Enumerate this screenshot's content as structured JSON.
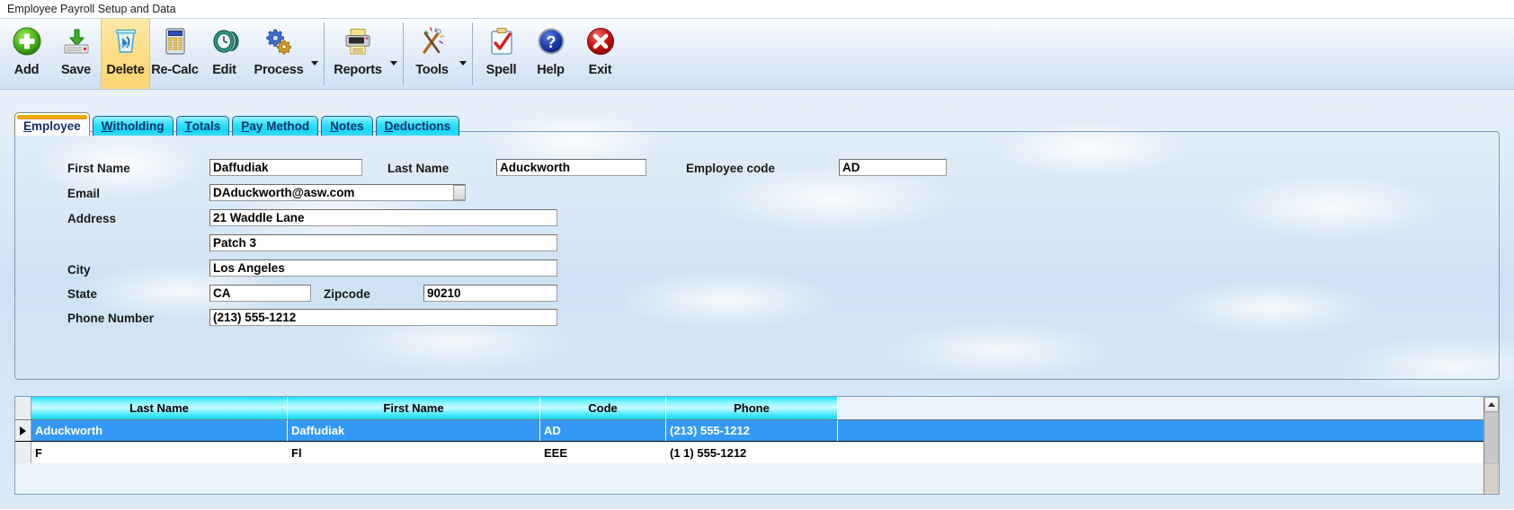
{
  "window": {
    "title": "Employee Payroll Setup and Data"
  },
  "toolbar": {
    "buttons": [
      {
        "label": "Add",
        "icon": "add-circle-icon",
        "active": false,
        "dropdown": false
      },
      {
        "label": "Save",
        "icon": "save-disk-icon",
        "active": false,
        "dropdown": false
      },
      {
        "label": "Delete",
        "icon": "trash-can-icon",
        "active": true,
        "dropdown": false
      },
      {
        "label": "Re-Calc",
        "icon": "calculator-icon",
        "active": false,
        "dropdown": false
      },
      {
        "label": "Edit",
        "icon": "clock-icon",
        "active": false,
        "dropdown": false
      },
      {
        "label": "Process",
        "icon": "gears-icon",
        "active": false,
        "dropdown": true
      },
      {
        "label": "Reports",
        "icon": "printer-icon",
        "active": false,
        "dropdown": true
      },
      {
        "label": "Tools",
        "icon": "tools-icon",
        "active": false,
        "dropdown": true
      },
      {
        "label": "Spell",
        "icon": "clipboard-check-icon",
        "active": false,
        "dropdown": false
      },
      {
        "label": "Help",
        "icon": "help-question-icon",
        "active": false,
        "dropdown": false
      },
      {
        "label": "Exit",
        "icon": "close-x-icon",
        "active": false,
        "dropdown": false
      }
    ]
  },
  "tabs": [
    {
      "label": "Employee",
      "accel": "E",
      "active": true
    },
    {
      "label": "Witholding",
      "accel": "W",
      "active": false
    },
    {
      "label": "Totals",
      "accel": "T",
      "active": false
    },
    {
      "label": "Pay Method",
      "accel": "P",
      "active": false
    },
    {
      "label": "Notes",
      "accel": "N",
      "active": false
    },
    {
      "label": "Deductions",
      "accel": "D",
      "active": false
    }
  ],
  "form": {
    "first_name_label": "First Name",
    "first_name_value": "Daffudiak",
    "last_name_label": "Last Name",
    "last_name_value": "Aduckworth",
    "employee_code_label": "Employee code",
    "employee_code_value": "AD",
    "email_label": "Email",
    "email_value": "DAduckworth@asw.com",
    "address_label": "Address",
    "address1_value": "21 Waddle Lane",
    "address2_value": "Patch 3",
    "city_label": "City",
    "city_value": "Los Angeles",
    "state_label": "State",
    "state_value": "CA",
    "zipcode_label": "Zipcode",
    "zipcode_value": "90210",
    "phone_label": "Phone Number",
    "phone_value": "(213) 555-1212"
  },
  "grid": {
    "columns": [
      "Last Name",
      "First Name",
      "Code",
      "Phone"
    ],
    "rows": [
      {
        "selected": true,
        "cells": [
          "Aduckworth",
          "Daffudiak",
          "AD",
          "(213) 555-1212"
        ]
      },
      {
        "selected": false,
        "cells": [
          "F",
          "Fl",
          "EEE",
          "(1 1) 555-1212"
        ]
      }
    ]
  },
  "colors": {
    "accent_tab": "#16d7f7",
    "active_tab_bar": "#f4b000",
    "grid_selection": "#3399f5",
    "toolbar_active": "#fddd84",
    "sky": "#cfe1f2"
  }
}
